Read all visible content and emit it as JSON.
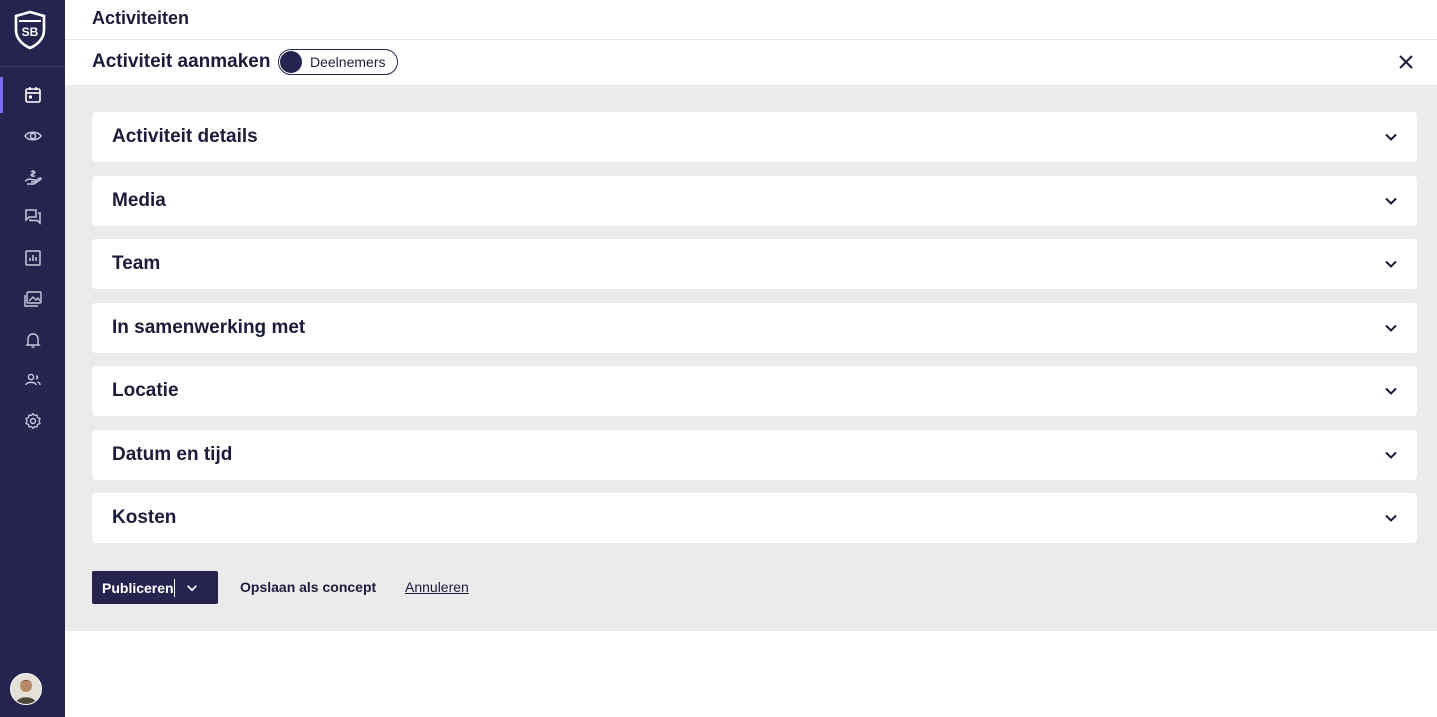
{
  "sidebar": {
    "logo_text": "SB",
    "items": [
      {
        "icon": "calendar-icon",
        "active": true
      },
      {
        "icon": "eye-icon",
        "active": false
      },
      {
        "icon": "hand-donation-icon",
        "active": false
      },
      {
        "icon": "chat-icon",
        "active": false
      },
      {
        "icon": "bar-chart-icon",
        "active": false
      },
      {
        "icon": "gallery-icon",
        "active": false
      },
      {
        "icon": "bell-icon",
        "active": false
      },
      {
        "icon": "users-icon",
        "active": false
      },
      {
        "icon": "gear-icon",
        "active": false
      }
    ],
    "avatar": "user-avatar"
  },
  "header": {
    "title": "Activiteiten",
    "subtitle": "Activiteit aanmaken",
    "toggle_label": "Deelnemers",
    "close_icon": "close-icon"
  },
  "sections": [
    {
      "title": "Activiteit details"
    },
    {
      "title": "Media"
    },
    {
      "title": "Team"
    },
    {
      "title": "In samenwerking met"
    },
    {
      "title": "Locatie"
    },
    {
      "title": "Datum en tijd"
    },
    {
      "title": "Kosten"
    }
  ],
  "actions": {
    "publish_label": "Publiceren",
    "save_concept_label": "Opslaan als concept",
    "cancel_label": "Annuleren"
  },
  "colors": {
    "sidebar_bg": "#26244f",
    "content_bg": "#ebebeb",
    "primary": "#26244f"
  }
}
